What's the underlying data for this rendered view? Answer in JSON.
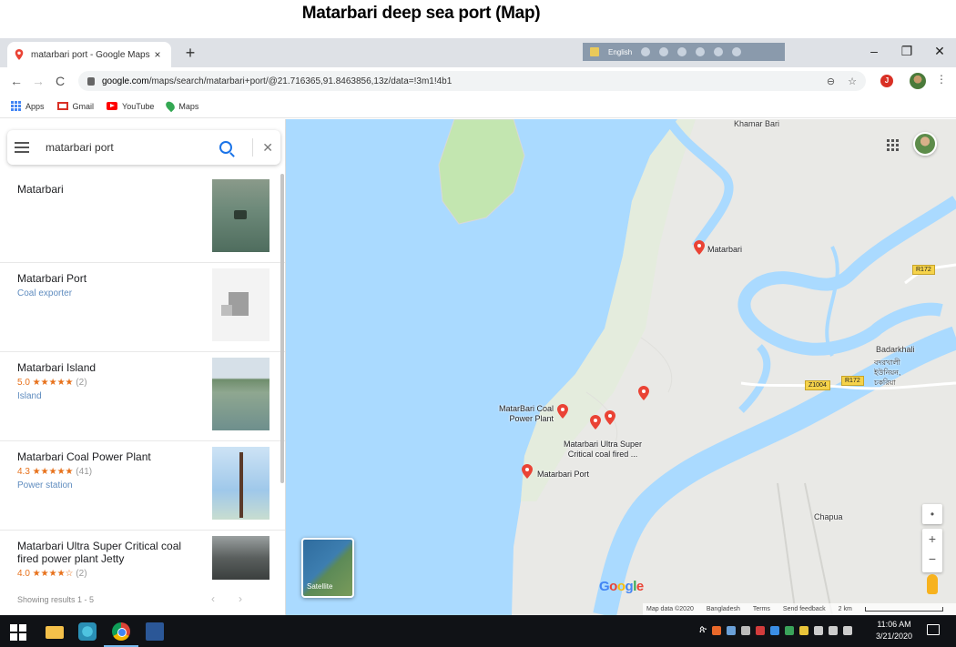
{
  "caption": "Matarbari deep sea port (Map)",
  "browser": {
    "tab_title": "matarbari port - Google Maps",
    "tab_close": "×",
    "new_tab": "+",
    "overlay_label": "English",
    "window_minimize": "–",
    "window_restore": "❐",
    "window_close": "✕",
    "back": "←",
    "forward": "→",
    "reload": "C",
    "url_host": "google.com",
    "url_path": "/maps/search/matarbari+port/@21.716365,91.8463856,13z/data=!3m1!4b1",
    "star": "☆",
    "extension_badge": "J",
    "menu": "⋮"
  },
  "bookmarks": [
    {
      "label": "Apps",
      "icon": "apps-grid-icon"
    },
    {
      "label": "Gmail",
      "icon": "gmail-icon"
    },
    {
      "label": "YouTube",
      "icon": "youtube-icon"
    },
    {
      "label": "Maps",
      "icon": "maps-pin-icon"
    }
  ],
  "search": {
    "value": "matarbari port"
  },
  "results": [
    {
      "name": "Matarbari",
      "rating": "",
      "count": "",
      "category": "",
      "thumb": "water"
    },
    {
      "name": "Matarbari Port",
      "rating": "",
      "count": "",
      "category": "Coal exporter",
      "thumb": "building"
    },
    {
      "name": "Matarbari Island",
      "rating": "5.0 ★★★★★",
      "count": "(2)",
      "category": "Island",
      "thumb": "island"
    },
    {
      "name": "Matarbari Coal Power Plant",
      "rating": "4.3 ★★★★★",
      "count": "(41)",
      "category": "Power station",
      "thumb": "tower"
    },
    {
      "name": "Matarbari Ultra Super Critical coal fired power plant Jetty",
      "rating": "4.0 ★★★★☆",
      "count": "(2)",
      "category": "",
      "thumb": "jetty"
    }
  ],
  "panel_footer": {
    "status": "Showing results 1 - 5",
    "prev": "‹",
    "next": "›"
  },
  "collapse_arrow": "◂",
  "map": {
    "labels": {
      "khamar_bari": "Khamar Bari",
      "badarkhali": "Badarkhali",
      "badarkhali_bn": "বদরখালী ইউনিয়ন, চকরিয়া",
      "chapua": "Chapua"
    },
    "pins": {
      "matarbari": "Matarbari",
      "coal_plant_line1": "MatarBari Coal",
      "coal_plant_line2": "Power Plant",
      "ultra_line1": "Matarbari Ultra Super",
      "ultra_line2": "Critical coal fired ...",
      "port": "Matarbari Port"
    },
    "roads": {
      "r172_top": "R172",
      "r172_mid": "R172",
      "z1004": "Z1004"
    },
    "satellite_label": "Satellite",
    "zoom_in": "+",
    "zoom_out": "−",
    "locate": "•",
    "google_logo": "Google",
    "attribution": {
      "map_data": "Map data ©2020",
      "country": "Bangladesh",
      "terms": "Terms",
      "feedback": "Send feedback",
      "scale": "2 km"
    },
    "colors": {
      "water": "#aadaff",
      "land": "#e8e8e5",
      "green": "#c3e6b0",
      "pin": "#ea4335"
    }
  },
  "taskbar": {
    "time": "11:06 AM",
    "date": "3/21/2020",
    "tray_prefix": "ጵ"
  }
}
